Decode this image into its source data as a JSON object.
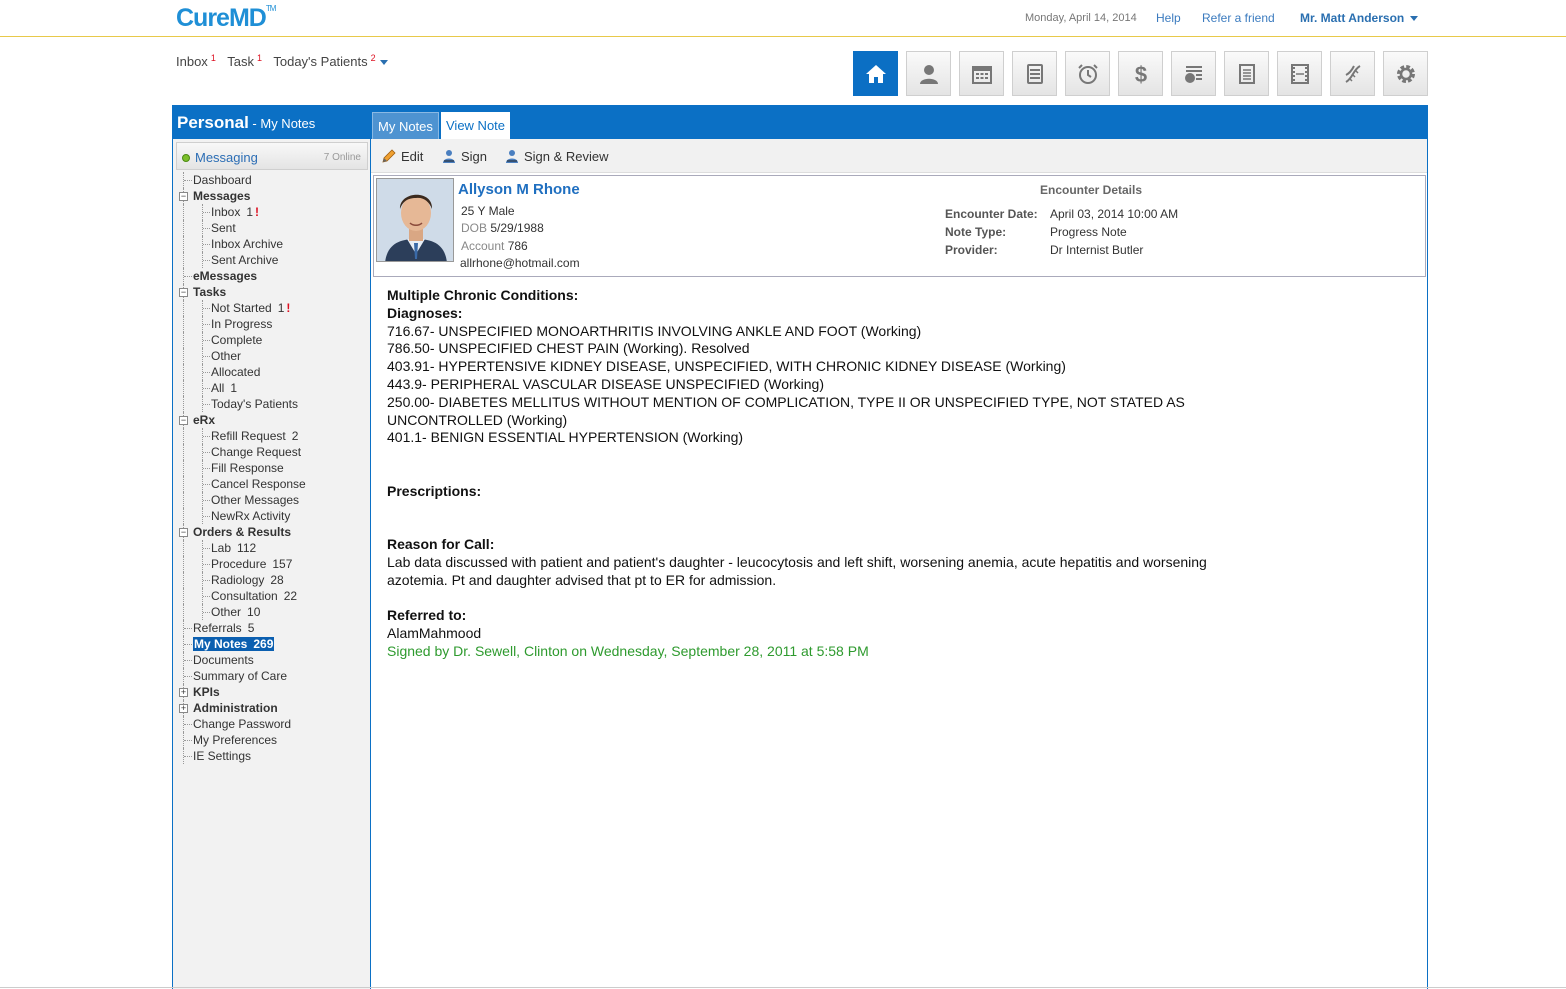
{
  "header": {
    "logo": "CureMD",
    "logo_tm": "TM",
    "date": "Monday, April 14, 2014",
    "help": "Help",
    "refer": "Refer a friend",
    "user": "Mr. Matt Anderson"
  },
  "quick_links": [
    {
      "label": "Inbox",
      "count": "1"
    },
    {
      "label": "Task",
      "count": "1"
    },
    {
      "label": "Today's Patients",
      "count": "2"
    }
  ],
  "toolbar_icons": [
    "home-icon",
    "patient-icon",
    "calendar-icon",
    "cabinet-icon",
    "alarm-icon",
    "dollar-icon",
    "billing-icon",
    "document-icon",
    "film-icon",
    "dna-icon",
    "settings-icon"
  ],
  "panel": {
    "title": "Personal",
    "subtitle": " - My Notes"
  },
  "tabs": [
    {
      "label": "My Notes"
    },
    {
      "label": "View Note"
    }
  ],
  "messaging": {
    "label": "Messaging",
    "online": "7 Online"
  },
  "tree": [
    {
      "label": "Dashboard",
      "level": 0
    },
    {
      "label": "Messages",
      "level": 0,
      "bold": true,
      "toggle": "-"
    },
    {
      "label": "Inbox",
      "level": 1,
      "count": "1",
      "alert": "!"
    },
    {
      "label": "Sent",
      "level": 1
    },
    {
      "label": "Inbox Archive",
      "level": 1
    },
    {
      "label": "Sent Archive",
      "level": 1
    },
    {
      "label": "eMessages",
      "level": 0,
      "bold": true
    },
    {
      "label": "Tasks",
      "level": 0,
      "bold": true,
      "toggle": "-"
    },
    {
      "label": "Not Started",
      "level": 1,
      "count": "1",
      "alert": "!"
    },
    {
      "label": "In Progress",
      "level": 1
    },
    {
      "label": "Complete",
      "level": 1
    },
    {
      "label": "Other",
      "level": 1
    },
    {
      "label": "Allocated",
      "level": 1
    },
    {
      "label": "All",
      "level": 1,
      "count": "1"
    },
    {
      "label": "Today's Patients",
      "level": 1
    },
    {
      "label": "eRx",
      "level": 0,
      "bold": true,
      "toggle": "-"
    },
    {
      "label": "Refill Request",
      "level": 1,
      "count": "2"
    },
    {
      "label": "Change Request",
      "level": 1
    },
    {
      "label": "Fill Response",
      "level": 1
    },
    {
      "label": "Cancel Response",
      "level": 1
    },
    {
      "label": "Other Messages",
      "level": 1
    },
    {
      "label": "NewRx Activity",
      "level": 1
    },
    {
      "label": "Orders & Results",
      "level": 0,
      "bold": true,
      "toggle": "-"
    },
    {
      "label": "Lab",
      "level": 1,
      "count": "112"
    },
    {
      "label": "Procedure",
      "level": 1,
      "count": "157"
    },
    {
      "label": "Radiology",
      "level": 1,
      "count": "28"
    },
    {
      "label": "Consultation",
      "level": 1,
      "count": "22"
    },
    {
      "label": "Other",
      "level": 1,
      "count": "10"
    },
    {
      "label": "Referrals",
      "level": 0,
      "count": "5"
    },
    {
      "label": "My Notes",
      "level": 0,
      "count": "269",
      "selected": true
    },
    {
      "label": "Documents",
      "level": 0
    },
    {
      "label": "Summary of Care",
      "level": 0
    },
    {
      "label": "KPIs",
      "level": 0,
      "bold": true,
      "toggle": "+"
    },
    {
      "label": "Administration",
      "level": 0,
      "bold": true,
      "toggle": "+"
    },
    {
      "label": "Change Password",
      "level": 0
    },
    {
      "label": "My Preferences",
      "level": 0
    },
    {
      "label": "IE Settings",
      "level": 0
    }
  ],
  "actions": {
    "edit": "Edit",
    "sign": "Sign",
    "sign_review": "Sign & Review"
  },
  "patient": {
    "name": "Allyson M Rhone",
    "age_sex": "25 Y Male",
    "dob_label": "DOB",
    "dob": "5/29/1988",
    "account_label": "Account",
    "account": "786",
    "email": "allrhone@hotmail.com"
  },
  "encounter": {
    "title": "Encounter Details",
    "date_label": "Encounter Date:",
    "date": "April 03, 2014 10:00 AM",
    "type_label": "Note Type:",
    "type": "Progress Note",
    "provider_label": "Provider:",
    "provider": "Dr Internist Butler"
  },
  "note": {
    "conditions_heading": "Multiple Chronic Conditions:",
    "diagnoses_heading": "Diagnoses:",
    "diagnoses": [
      "716.67- UNSPECIFIED MONOARTHRITIS INVOLVING ANKLE AND FOOT (Working)",
      "786.50- UNSPECIFIED CHEST PAIN (Working). Resolved",
      "403.91- HYPERTENSIVE KIDNEY DISEASE, UNSPECIFIED, WITH CHRONIC KIDNEY DISEASE (Working)",
      "443.9- PERIPHERAL VASCULAR DISEASE UNSPECIFIED (Working)",
      "250.00- DIABETES MELLITUS WITHOUT MENTION OF COMPLICATION, TYPE II OR UNSPECIFIED TYPE, NOT STATED AS",
      "UNCONTROLLED (Working)",
      "401.1- BENIGN ESSENTIAL HYPERTENSION (Working)"
    ],
    "prescriptions_heading": "Prescriptions:",
    "reason_heading": "Reason for Call:",
    "reason_lines": [
      "Lab data discussed with patient and patient's daughter - leucocytosis and left shift, worsening anemia, acute hepatitis and worsening",
      "azotemia. Pt and daughter advised that pt to ER for admission."
    ],
    "referred_heading": "Referred to:",
    "referred": "AlamMahmood",
    "signed": "Signed by Dr. Sewell, Clinton on Wednesday, September 28, 2011 at 5:58 PM"
  },
  "colors": {
    "brand_blue": "#0b70c5",
    "alert_red": "#dd1122",
    "signed_green": "#2e9a2e"
  }
}
